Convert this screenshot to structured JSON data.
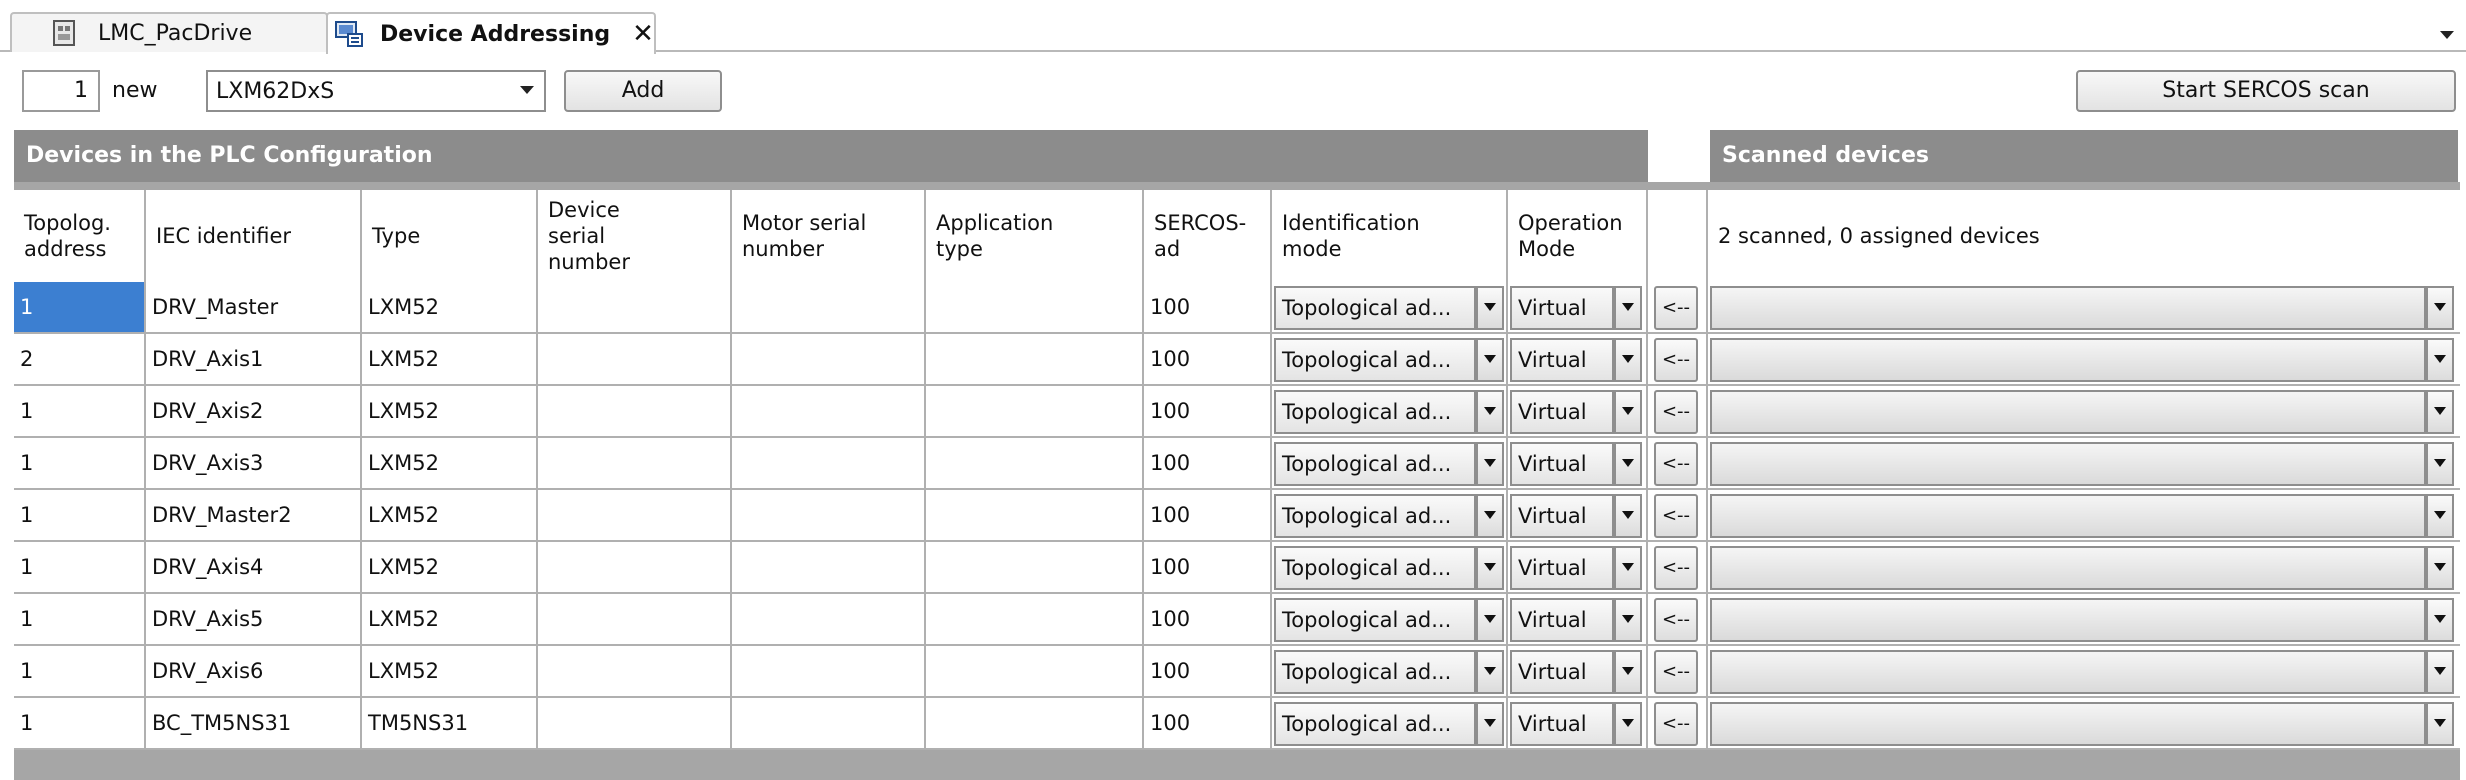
{
  "tabs": [
    {
      "label": "LMC_PacDrive",
      "active": false,
      "icon": "project-icon"
    },
    {
      "label": "Device Addressing",
      "active": true,
      "icon": "device-addressing-icon",
      "close": "✕"
    }
  ],
  "toolbar": {
    "count_value": "1",
    "new_label": "new",
    "device_type_selected": "LXM62DxS",
    "add_label": "Add",
    "scan_label": "Start SERCOS scan"
  },
  "plc_section": {
    "title": "Devices in the PLC Configuration"
  },
  "scanned_section": {
    "title": "Scanned devices",
    "summary": "2 scanned, 0 assigned devices"
  },
  "columns": [
    "Topolog.\naddress",
    "IEC identifier",
    "Type",
    "Device\nserial\nnumber",
    "Motor serial\nnumber",
    "Application\ntype",
    "SERCOS-ad",
    "Identification\nmode",
    "Operation\nMode"
  ],
  "assign_button_label": "<--",
  "rows": [
    {
      "topo": "1",
      "iec": "DRV_Master",
      "type": "LXM52",
      "sercos": "100",
      "id_mode": "Topological ad...",
      "op_mode": "Virtual"
    },
    {
      "topo": "2",
      "iec": "DRV_Axis1",
      "type": "LXM52",
      "sercos": "100",
      "id_mode": "Topological ad...",
      "op_mode": "Virtual"
    },
    {
      "topo": "1",
      "iec": "DRV_Axis2",
      "type": "LXM52",
      "sercos": "100",
      "id_mode": "Topological ad...",
      "op_mode": "Virtual"
    },
    {
      "topo": "1",
      "iec": "DRV_Axis3",
      "type": "LXM52",
      "sercos": "100",
      "id_mode": "Topological ad...",
      "op_mode": "Virtual"
    },
    {
      "topo": "1",
      "iec": "DRV_Master2",
      "type": "LXM52",
      "sercos": "100",
      "id_mode": "Topological ad...",
      "op_mode": "Virtual"
    },
    {
      "topo": "1",
      "iec": "DRV_Axis4",
      "type": "LXM52",
      "sercos": "100",
      "id_mode": "Topological ad...",
      "op_mode": "Virtual"
    },
    {
      "topo": "1",
      "iec": "DRV_Axis5",
      "type": "LXM52",
      "sercos": "100",
      "id_mode": "Topological ad...",
      "op_mode": "Virtual"
    },
    {
      "topo": "1",
      "iec": "DRV_Axis6",
      "type": "LXM52",
      "sercos": "100",
      "id_mode": "Topological ad...",
      "op_mode": "Virtual"
    },
    {
      "topo": "1",
      "iec": "BC_TM5NS31",
      "type": "TM5NS31",
      "sercos": "100",
      "id_mode": "Topological ad...",
      "op_mode": "Virtual"
    }
  ],
  "colors": {
    "selection": "#3c7fd1",
    "section_header": "#8c8c8c"
  }
}
